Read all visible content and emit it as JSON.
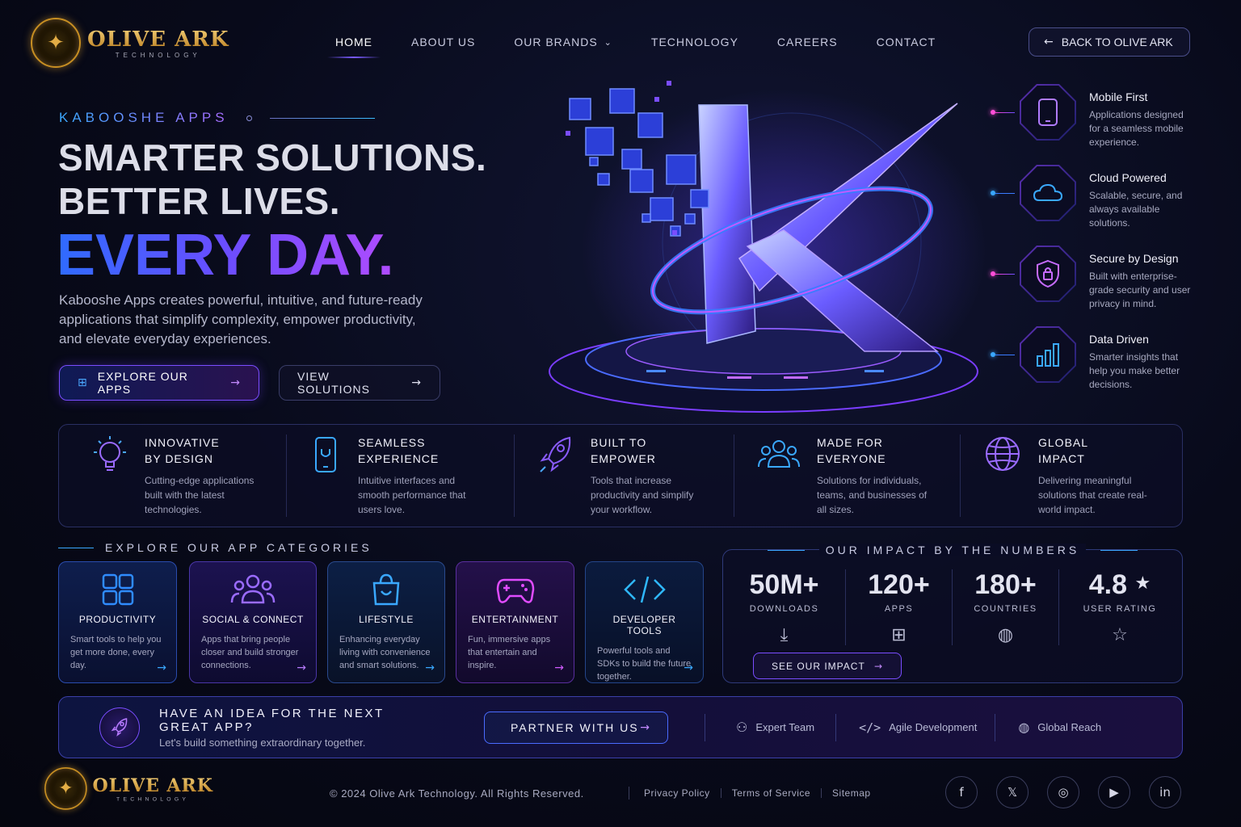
{
  "brand": {
    "name": "OLIVE ARK",
    "sub": "TECHNOLOGY"
  },
  "nav": {
    "items": [
      "HOME",
      "ABOUT US",
      "OUR BRANDS",
      "TECHNOLOGY",
      "CAREERS",
      "CONTACT"
    ],
    "back": "BACK TO OLIVE ARK"
  },
  "hero": {
    "eyebrow": "KABOOSHE APPS",
    "line1": "SMARTER SOLUTIONS.",
    "line2": "BETTER LIVES.",
    "line3": "EVERY DAY.",
    "para": "Kabooshe Apps creates powerful, intuitive, and future-ready applications that simplify complexity, empower productivity, and elevate everyday experiences.",
    "cta_primary": "EXPLORE OUR APPS",
    "cta_secondary": "VIEW SOLUTIONS"
  },
  "features": [
    {
      "title": "Mobile First",
      "desc": "Applications designed for a seamless mobile experience.",
      "icon": "phone-icon"
    },
    {
      "title": "Cloud Powered",
      "desc": "Scalable, secure, and always available solutions.",
      "icon": "cloud-icon"
    },
    {
      "title": "Secure by Design",
      "desc": "Built with enterprise-grade security and user privacy in mind.",
      "icon": "shield-lock-icon"
    },
    {
      "title": "Data Driven",
      "desc": "Smarter insights that help you make better decisions.",
      "icon": "bar-chart-icon"
    }
  ],
  "strip": [
    {
      "t1": "INNOVATIVE",
      "t2": "BY DESIGN",
      "desc": "Cutting-edge applications built with the latest technologies.",
      "icon": "lightbulb-icon"
    },
    {
      "t1": "SEAMLESS",
      "t2": "EXPERIENCE",
      "desc": "Intuitive interfaces and smooth performance that users love.",
      "icon": "smartphone-icon"
    },
    {
      "t1": "BUILT TO",
      "t2": "EMPOWER",
      "desc": "Tools that increase productivity and simplify your workflow.",
      "icon": "rocket-icon"
    },
    {
      "t1": "MADE FOR",
      "t2": "EVERYONE",
      "desc": "Solutions for individuals, teams, and businesses of all sizes.",
      "icon": "users-icon"
    },
    {
      "t1": "GLOBAL",
      "t2": "IMPACT",
      "desc": "Delivering meaningful solutions that create real-world impact.",
      "icon": "globe-icon"
    }
  ],
  "categories": {
    "heading": "EXPLORE OUR APP CATEGORIES",
    "items": [
      {
        "title": "PRODUCTIVITY",
        "desc": "Smart tools to help you get more done, every day.",
        "icon": "grid-icon",
        "color": "#2f8bff"
      },
      {
        "title": "SOCIAL & CONNECT",
        "desc": "Apps that bring people closer and build stronger connections.",
        "icon": "users-icon",
        "color": "#8a5bff"
      },
      {
        "title": "LIFESTYLE",
        "desc": "Enhancing everyday living with convenience and smart solutions.",
        "icon": "shopping-bag-icon",
        "color": "#3aa8ff"
      },
      {
        "title": "ENTERTAINMENT",
        "desc": "Fun, immersive apps that entertain and inspire.",
        "icon": "gamepad-icon",
        "color": "#e04cff"
      },
      {
        "title": "DEVELOPER TOOLS",
        "desc": "Powerful tools and SDKs to build the future together.",
        "icon": "code-icon",
        "color": "#2fb8ff"
      }
    ]
  },
  "impact": {
    "heading": "OUR IMPACT BY THE NUMBERS",
    "stats": [
      {
        "num": "50M+",
        "label": "DOWNLOADS",
        "icon": "download-icon"
      },
      {
        "num": "120+",
        "label": "APPS",
        "icon": "grid-icon"
      },
      {
        "num": "180+",
        "label": "COUNTRIES",
        "icon": "globe-icon"
      },
      {
        "num": "4.8",
        "label": "USER RATING",
        "icon": "star-icon"
      }
    ],
    "cta": "SEE OUR IMPACT"
  },
  "banner": {
    "title": "HAVE AN IDEA FOR THE NEXT GREAT APP?",
    "sub": "Let's build something extraordinary together.",
    "cta": "PARTNER WITH US",
    "badges": [
      "Expert Team",
      "Agile Development",
      "Global Reach"
    ]
  },
  "footer": {
    "copyright": "© 2024 Olive Ark Technology. All Rights Reserved.",
    "links": [
      "Privacy Policy",
      "Terms of Service",
      "Sitemap"
    ],
    "social": [
      "f",
      "𝕏",
      "◎",
      "▶",
      "in"
    ]
  },
  "colors": {
    "accent_blue": "#2f6bff",
    "accent_purple": "#a24cff",
    "accent_pink": "#ff4fd8",
    "gold": "#d59a2a"
  }
}
